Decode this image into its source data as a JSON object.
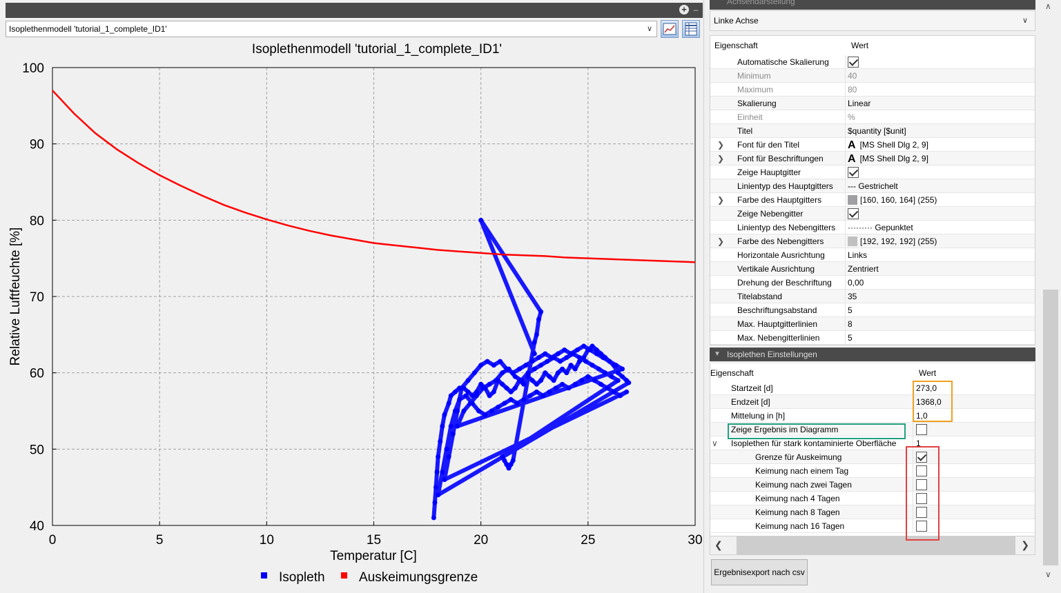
{
  "model_select": {
    "value": "Isoplethenmodell 'tutorial_1_complete_ID1'"
  },
  "chart_data": {
    "type": "scatter",
    "title": "Isoplethenmodell 'tutorial_1_complete_ID1'",
    "xlabel": "Temperatur [C]",
    "ylabel": "Relative Luftfeuchte [%]",
    "xlim": [
      0,
      30
    ],
    "ylim": [
      40,
      100
    ],
    "x_ticks": [
      0,
      5,
      10,
      15,
      20,
      25,
      30
    ],
    "y_ticks": [
      40,
      50,
      60,
      70,
      80,
      90,
      100
    ],
    "grid": true,
    "legend_position": "bottom-center",
    "series": [
      {
        "name": "Isopleth",
        "color": "#0000ff",
        "kind": "scatter",
        "x": [
          17.8,
          17.85,
          17.9,
          17.95,
          18.0,
          18.1,
          18.2,
          18.3,
          18.5,
          18.6,
          18.8,
          19.0,
          19.2,
          19.4,
          19.6,
          19.8,
          20.0,
          20.2,
          20.4,
          20.6,
          20.8,
          21.0,
          21.2,
          21.4,
          21.6,
          21.8,
          22.0,
          22.2,
          22.4,
          22.6,
          22.8,
          23.0,
          23.2,
          23.4,
          23.6,
          23.8,
          24.0,
          24.2,
          24.4,
          24.6,
          24.8,
          25.0,
          25.2,
          25.4,
          25.6,
          25.8,
          26.0,
          26.2,
          26.4,
          26.6,
          26.8,
          26.9,
          18.0,
          18.2,
          18.4,
          18.6,
          18.8,
          19.0,
          19.3,
          19.6,
          19.9,
          20.2,
          20.5,
          20.8,
          21.1,
          21.4,
          21.7,
          22.0,
          22.3,
          22.6,
          22.9,
          23.2,
          23.5,
          23.8,
          24.1,
          24.4,
          24.7,
          25.0,
          25.3,
          25.6,
          25.9,
          26.2,
          26.5,
          26.8,
          18.3,
          18.5,
          18.7,
          18.9,
          19.1,
          19.4,
          19.7,
          20.0,
          20.3,
          20.6,
          20.9,
          21.2,
          21.5,
          21.8,
          22.1,
          22.4,
          22.7,
          23.0,
          23.3,
          23.6,
          23.9,
          24.2,
          24.5,
          24.8,
          25.1,
          25.4,
          25.7,
          26.0,
          26.3,
          26.6,
          18.9,
          19.2,
          19.5,
          19.8,
          20.1,
          20.4,
          20.7,
          21.0,
          21.3,
          21.6,
          21.9,
          22.2,
          22.5,
          22.8,
          23.1,
          23.4,
          23.7,
          24.0,
          24.3,
          24.6,
          24.9,
          25.2,
          25.5,
          25.8,
          26.1,
          26.4,
          21.0,
          21.1,
          21.2,
          21.3,
          21.4,
          21.5,
          22.5,
          22.6,
          22.7,
          22.8,
          20.0,
          22.5
        ],
        "y": [
          41.0,
          43.0,
          45.0,
          47.0,
          49.0,
          51.0,
          53.0,
          54.5,
          56.0,
          57.0,
          57.5,
          58.0,
          58.0,
          57.5,
          57.0,
          57.5,
          58.5,
          58.0,
          57.0,
          57.5,
          59.0,
          58.5,
          58.0,
          57.5,
          58.0,
          59.0,
          58.5,
          59.5,
          59.0,
          58.5,
          59.0,
          60.0,
          59.5,
          59.0,
          60.0,
          60.5,
          60.0,
          61.0,
          60.5,
          61.5,
          62.0,
          63.0,
          63.5,
          63.0,
          62.5,
          62.0,
          61.5,
          61.0,
          60.0,
          59.5,
          59.0,
          58.7,
          44.0,
          47.0,
          50.0,
          53.0,
          55.0,
          56.5,
          57.0,
          56.0,
          55.0,
          54.5,
          55.0,
          55.5,
          56.0,
          56.5,
          56.0,
          56.5,
          57.0,
          57.5,
          57.0,
          57.5,
          58.0,
          58.5,
          58.0,
          58.5,
          59.0,
          59.5,
          59.0,
          58.5,
          58.0,
          57.5,
          57.0,
          57.5,
          46.0,
          49.0,
          52.0,
          55.0,
          58.0,
          59.0,
          60.0,
          61.0,
          61.5,
          61.0,
          61.5,
          60.5,
          60.0,
          60.5,
          61.0,
          61.5,
          62.0,
          62.5,
          62.0,
          62.5,
          63.0,
          62.5,
          63.0,
          63.5,
          63.0,
          62.5,
          62.0,
          61.5,
          61.0,
          60.5,
          53.0,
          55.0,
          56.0,
          57.0,
          58.0,
          58.5,
          59.0,
          60.0,
          60.5,
          59.5,
          59.0,
          60.0,
          60.5,
          61.0,
          61.5,
          62.0,
          61.5,
          62.0,
          62.5,
          62.0,
          61.5,
          61.0,
          60.5,
          60.0,
          59.5,
          59.0,
          49.0,
          48.5,
          48.0,
          47.5,
          48.0,
          48.5,
          64.0,
          65.0,
          67.0,
          68.0,
          80.0,
          62.5
        ]
      },
      {
        "name": "Auskeimungsgrenze",
        "color": "#ff0000",
        "kind": "line",
        "x": [
          0,
          1,
          2,
          3,
          4,
          5,
          6,
          7,
          8,
          9,
          10,
          11,
          12,
          13,
          14,
          15,
          16,
          17,
          18,
          19,
          20,
          21,
          22,
          23,
          24,
          25,
          26,
          27,
          28,
          29,
          30
        ],
        "y": [
          97.0,
          94.0,
          91.4,
          89.3,
          87.5,
          85.9,
          84.5,
          83.2,
          82.0,
          81.0,
          80.1,
          79.3,
          78.6,
          78.0,
          77.5,
          77.0,
          76.7,
          76.4,
          76.1,
          75.9,
          75.7,
          75.5,
          75.4,
          75.3,
          75.1,
          75.0,
          74.9,
          74.8,
          74.7,
          74.6,
          74.5
        ]
      }
    ]
  },
  "section1": {
    "header": "Achsendarstellung",
    "axis_select": "Linke Achse",
    "col_property": "Eigenschaft",
    "col_value": "Wert",
    "rows": [
      {
        "label": "Automatische Skalierung",
        "type": "check",
        "checked": true
      },
      {
        "label": "Minimum",
        "value": "40",
        "disabled": true
      },
      {
        "label": "Maximum",
        "value": "80",
        "disabled": true
      },
      {
        "label": "Skalierung",
        "value": "Linear"
      },
      {
        "label": "Einheit",
        "value": "%",
        "disabled": true
      },
      {
        "label": "Titel",
        "value": "$quantity [$unit]"
      },
      {
        "label": "Font für den Titel",
        "value": "[MS Shell Dlg 2, 9]",
        "expandable": true,
        "icon": "font-icon"
      },
      {
        "label": "Font für Beschriftungen",
        "value": "[MS Shell Dlg 2, 9]",
        "expandable": true,
        "icon": "font-icon"
      },
      {
        "label": "Zeige Hauptgitter",
        "type": "check",
        "checked": true
      },
      {
        "label": "Linientyp des Hauptgitters",
        "value": "Gestrichelt",
        "prefix": "---"
      },
      {
        "label": "Farbe des Hauptgitters",
        "value": "[160, 160, 164] (255)",
        "expandable": true,
        "swatch": "#a0a0a4"
      },
      {
        "label": "Zeige Nebengitter",
        "type": "check",
        "checked": true
      },
      {
        "label": "Linientyp des Nebengitters",
        "value": "Gepunktet",
        "prefix": "·········"
      },
      {
        "label": "Farbe des Nebengitters",
        "value": "[192, 192, 192] (255)",
        "expandable": true,
        "swatch": "#c0c0c0"
      },
      {
        "label": "Horizontale Ausrichtung",
        "value": "Links"
      },
      {
        "label": "Vertikale Ausrichtung",
        "value": "Zentriert"
      },
      {
        "label": "Drehung der Beschriftung",
        "value": "0,00"
      },
      {
        "label": "Titelabstand",
        "value": "35"
      },
      {
        "label": "Beschriftungsabstand",
        "value": "5"
      },
      {
        "label": "Max. Hauptgitterlinien",
        "value": "8"
      },
      {
        "label": "Max. Nebengitterlinien",
        "value": "5"
      }
    ]
  },
  "section2": {
    "header": "Isoplethen Einstellungen",
    "col_property": "Eigenschaft",
    "col_value": "Wert",
    "rows": [
      {
        "label": "Startzeit [d]",
        "value": "273,0",
        "indent": 1
      },
      {
        "label": "Endzeit [d]",
        "value": "1368,0",
        "indent": 1
      },
      {
        "label": "Mittelung in [h]",
        "value": "1,0",
        "indent": 1
      },
      {
        "label": "Zeige Ergebnis im Diagramm",
        "type": "check",
        "checked": false,
        "indent": 1
      },
      {
        "label": "Isoplethen für stark kontaminierte Oberfläche",
        "value": "1",
        "indent": 1,
        "expanded": true
      },
      {
        "label": "Grenze für Auskeimung",
        "type": "check",
        "checked": true,
        "indent": 2
      },
      {
        "label": "Keimung nach einem Tag",
        "type": "check",
        "checked": false,
        "indent": 2
      },
      {
        "label": "Keimung nach zwei Tagen",
        "type": "check",
        "checked": false,
        "indent": 2
      },
      {
        "label": "Keimung nach 4 Tagen",
        "type": "check",
        "checked": false,
        "indent": 2
      },
      {
        "label": "Keimung nach 8 Tagen",
        "type": "check",
        "checked": false,
        "indent": 2
      },
      {
        "label": "Keimung nach 16 Tagen",
        "type": "check",
        "checked": false,
        "indent": 2
      }
    ]
  },
  "export_button": {
    "label": "Ergebnisexport nach csv"
  },
  "highlights": {
    "orange": "#f0a020",
    "green": "#20a080",
    "red": "#e04040"
  }
}
